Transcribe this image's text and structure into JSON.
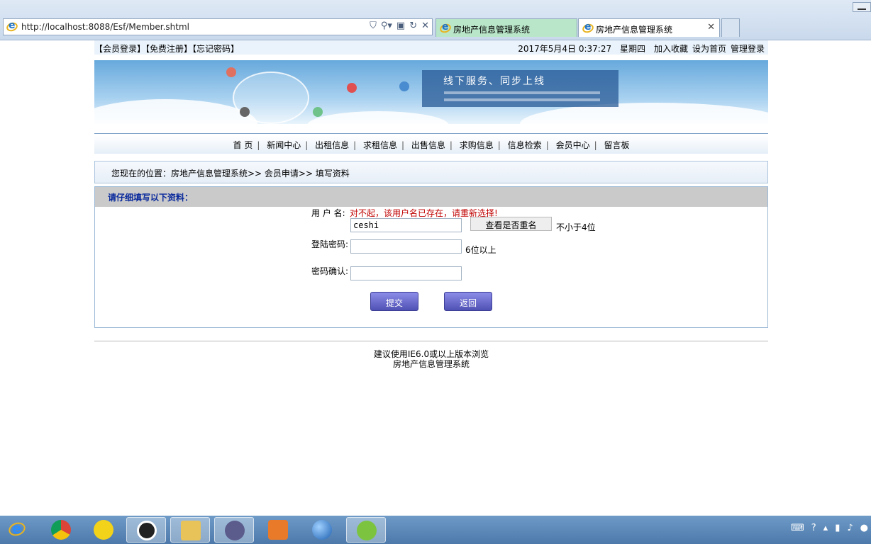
{
  "browser": {
    "url": "http://localhost:8088/Esf/Member.shtml",
    "tabs": [
      {
        "label": "房地产信息管理系统"
      },
      {
        "label": "房地产信息管理系统"
      }
    ]
  },
  "topbar": {
    "links_left": "【会员登录】【免费注册】【忘记密码】",
    "datetime": "2017年5月4日 0:37:27",
    "weekday": "星期四",
    "favorite": "加入收藏",
    "homepage": "设为首页",
    "admin_login": "管理登录"
  },
  "banner": {
    "slogan": "线下服务、同步上线"
  },
  "nav": {
    "items": [
      "首 页",
      "新闻中心",
      "出租信息",
      "求租信息",
      "出售信息",
      "求购信息",
      "信息检索",
      "会员中心",
      "留言板"
    ]
  },
  "breadcrumb": "您现在的位置：房地产信息管理系统>> 会员申请>> 填写资料",
  "form": {
    "heading": "请仔细填写以下资料：",
    "username_label": "用 户 名:",
    "username_error": "对不起，该用户名已存在，请重新选择!",
    "username_value": "ceshi",
    "check_button": "查看是否重名",
    "username_hint": "不小于4位",
    "password_label": "登陆密码:",
    "password_hint": "6位以上",
    "confirm_label": "密码确认:",
    "submit": "提交",
    "back": "返回"
  },
  "footer": {
    "line1": "建议使用IE6.0或以上版本浏览",
    "line2": "房地产信息管理系统"
  },
  "taskbar": {
    "apps": [
      "ie-icon",
      "chrome-icon",
      "music-icon",
      "qq-icon",
      "file-explorer-icon",
      "eclipse-icon",
      "media-player-icon",
      "sphere-icon",
      "green-app-icon"
    ]
  }
}
